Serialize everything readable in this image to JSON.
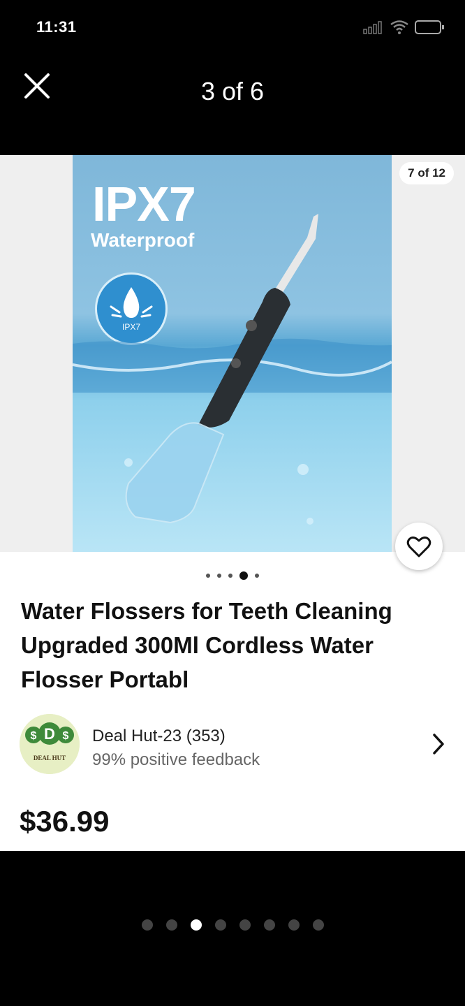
{
  "status": {
    "time": "11:31"
  },
  "header": {
    "title": "3 of 6"
  },
  "product": {
    "image_counter": "7 of 12",
    "image_text_title": "IPX7",
    "image_text_sub": "Waterproof",
    "image_badge_label": "IPX7",
    "title": "Water Flossers for Teeth Cleaning Upgraded 300Ml Cordless Water Flosser Portabl",
    "price": "$36.99",
    "image_dots": {
      "count": 5,
      "active": 3
    }
  },
  "seller": {
    "name": "Deal Hut-23 (353)",
    "feedback": "99% positive feedback",
    "logo_text": "DEAL HUT"
  },
  "pager": {
    "count": 8,
    "active": 2
  },
  "colors": {
    "accent_water": "#5aa8d4",
    "badge": "#2f8fcf",
    "logo_green": "#3e8a3a"
  }
}
